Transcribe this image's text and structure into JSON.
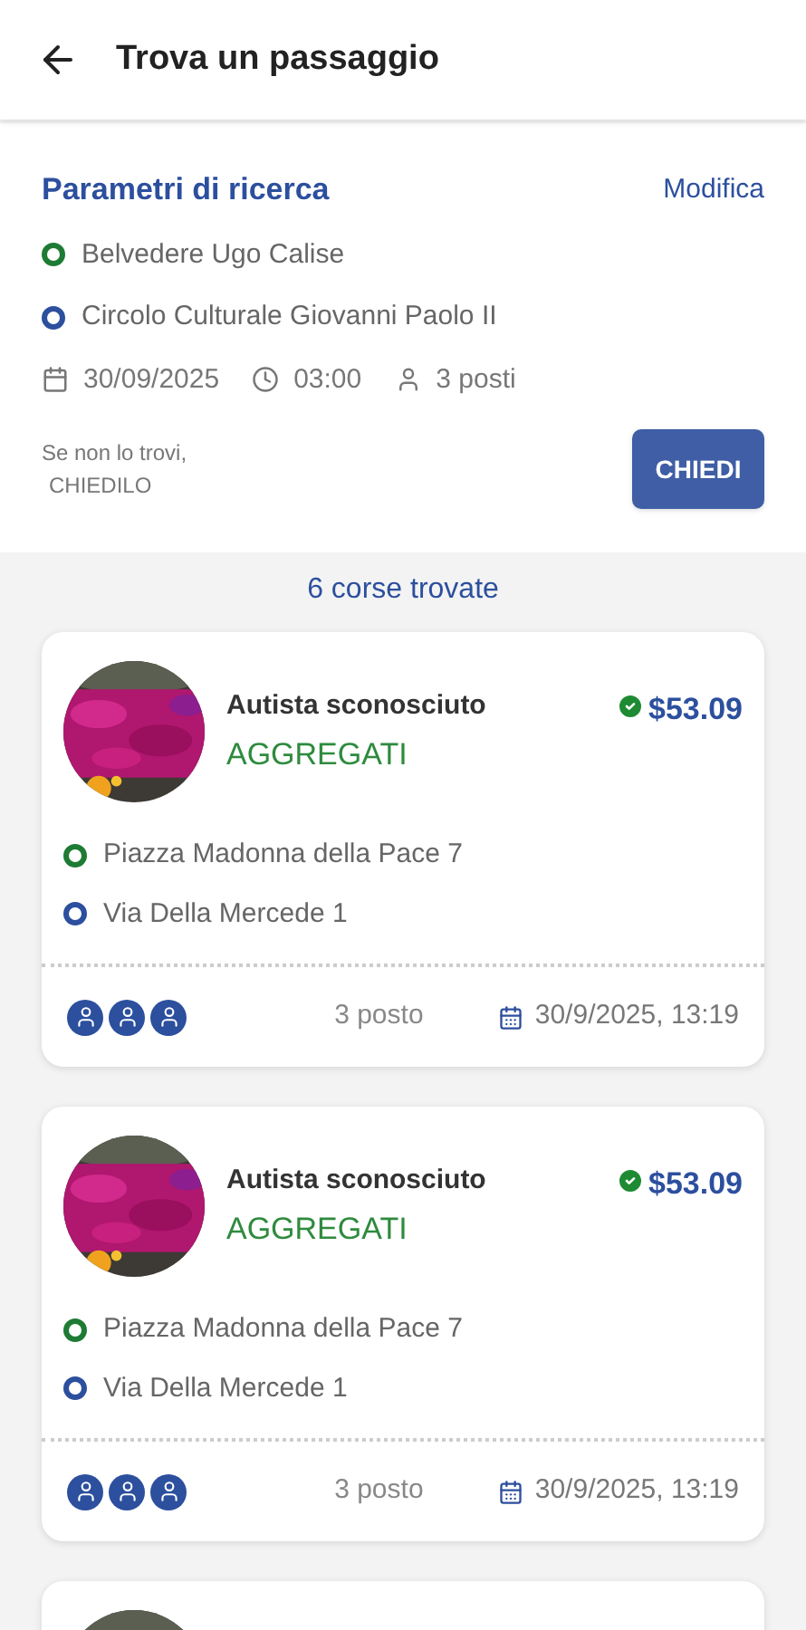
{
  "header": {
    "title": "Trova un passaggio"
  },
  "search": {
    "title": "Parametri di ricerca",
    "edit_link": "Modifica",
    "stops": [
      {
        "name": "Belvedere Ugo Calise",
        "color": "#1e7b34"
      },
      {
        "name": "Circolo Culturale Giovanni Paolo II",
        "color": "#2c4f9e"
      }
    ],
    "date": "30/09/2025",
    "time": "03:00",
    "seats": "3 posti",
    "hint_line1": "Se non lo trovi,",
    "hint_line2": "CHIEDILO",
    "ask_button": "CHIEDI"
  },
  "results_count": "6 corse trovate",
  "rides": [
    {
      "avatar": {
        "kind": "picture"
      },
      "driver": "Autista sconosciuto",
      "group": "AGGREGATI",
      "verified": true,
      "price": "$53.09",
      "stops": [
        {
          "name": "Piazza Madonna della Pace 7",
          "color": "#1e7b34"
        },
        {
          "name": "Via Della Mercede 1",
          "color": "#2c4f9e"
        }
      ],
      "seats": "3 posto",
      "datetime": "30/9/2025, 13:19"
    },
    {
      "avatar": {
        "kind": "picture"
      },
      "driver": "Autista sconosciuto",
      "group": "AGGREGATI",
      "verified": true,
      "price": "$53.09",
      "stops": [
        {
          "name": "Piazza Madonna della Pace 7",
          "color": "#1e7b34"
        },
        {
          "name": "Via Della Mercede 1",
          "color": "#2c4f9e"
        }
      ],
      "seats": "3 posto",
      "datetime": "30/9/2025, 13:19"
    },
    {
      "avatar": {
        "kind": "picture"
      }
    }
  ]
}
